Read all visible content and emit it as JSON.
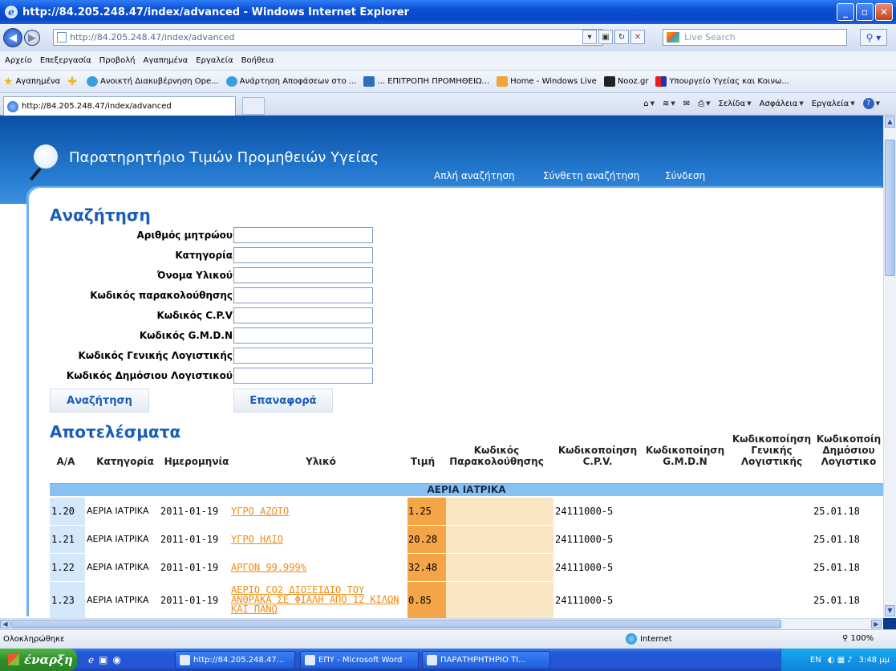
{
  "window": {
    "title": "http://84.205.248.47/index/advanced - Windows Internet Explorer"
  },
  "address": {
    "url": "http://84.205.248.47/index/advanced",
    "search_placeholder": "Live Search"
  },
  "menu": [
    "Αρχείο",
    "Επεξεργασία",
    "Προβολή",
    "Αγαπημένα",
    "Εργαλεία",
    "Βοήθεια"
  ],
  "favorites": {
    "label": "Αγαπημένα",
    "items": [
      "Ανοικτή Διακυβέρνηση Ope...",
      "Ανάρτηση Αποφάσεων στο ...",
      "... ΕΠΙΤΡΟΠΗ ΠΡΟΜΗΘΕΙΩ...",
      "Home - Windows Live",
      "Nooz.gr",
      "Υπουργείο Υγείας και Κοινω..."
    ]
  },
  "tab": {
    "label": "http://84.205.248.47/index/advanced"
  },
  "commands": [
    "Σελίδα",
    "Ασφάλεια",
    "Εργαλεία"
  ],
  "site": {
    "title": "Παρατηρητήριο Τιμών Προμηθειών Υγείας",
    "nav": [
      "Απλή αναζήτηση",
      "Σύνθετη αναζήτηση",
      "Σύνδεση"
    ]
  },
  "search": {
    "heading": "Αναζήτηση",
    "fields": [
      "Αριθμός μητρώου",
      "Κατηγορία",
      "Όνομα Υλικού",
      "Κωδικός παρακολούθησης",
      "Κωδικός C.P.V",
      "Κωδικός G.M.D.N",
      "Κωδικός Γενικής Λογιστικής",
      "Κωδικός Δημόσιου Λογιστικού"
    ],
    "submit_label": "Αναζήτηση",
    "reset_label": "Επαναφορά"
  },
  "results": {
    "heading": "Αποτελέσματα",
    "columns": {
      "id": "Α/Α",
      "category": "Κατηγορία",
      "date": "Ημερομηνία",
      "item": "Υλικό",
      "price": "Τιμή",
      "tracking": "Κωδικός Παρακολούθησης",
      "cpv": "Κωδικοποίηση C.P.V.",
      "gmdn": "Κωδικοποίηση G.M.D.N",
      "general": "Κωδικοποίηση Γενικής Λογιστικής",
      "public": "Κωδικοποίη Δημόσιου Λογιστικο"
    },
    "group": "ΑΕΡΙΑ ΙΑΤΡΙΚΑ",
    "rows": [
      {
        "id": "1.20",
        "category": "ΑΕΡΙΑ ΙΑΤΡΙΚΑ",
        "date": "2011-01-19",
        "item": "ΥΓΡΟ ΑΖΩΤΟ",
        "price": "1.25",
        "cpv": "24111000-5",
        "public": "25.01.18"
      },
      {
        "id": "1.21",
        "category": "ΑΕΡΙΑ ΙΑΤΡΙΚΑ",
        "date": "2011-01-19",
        "item": "ΥΓΡΟ ΗΛΙΟ",
        "price": "20.28",
        "cpv": "24111000-5",
        "public": "25.01.18"
      },
      {
        "id": "1.22",
        "category": "ΑΕΡΙΑ ΙΑΤΡΙΚΑ",
        "date": "2011-01-19",
        "item": "ΑΡΓΟΝ 99.999%",
        "price": "32.48",
        "cpv": "24111000-5",
        "public": "25.01.18"
      },
      {
        "id": "1.23",
        "category": "ΑΕΡΙΑ ΙΑΤΡΙΚΑ",
        "date": "2011-01-19",
        "item": "ΑΕΡΙΟ CO2 ΔΙΟΞΕΙΔΙΟ ΤΟΥ ΑΝΘΡΑΚΑ ΣΕ ΦΙΑΛΗ ΑΠΟ 12 ΚΙΛΩΝ ΚΑΙ ΠΑΝΩ",
        "price": "0.85",
        "cpv": "24111000-5",
        "public": "25.01.18"
      }
    ]
  },
  "status": {
    "text": "Ολοκληρώθηκε",
    "zone": "Internet",
    "zoom": "100%"
  },
  "taskbar": {
    "start": "έναρξη",
    "tasks": [
      "http://84.205.248.47...",
      "ΕΠΥ - Microsoft Word",
      "ΠΑΡΑΤΗΡΗΤΗΡΙΟ ΤΙ..."
    ],
    "lang": "EN",
    "clock": "3:48 μμ"
  },
  "colors": {
    "accent": "#1a5db8",
    "header": "#1f73c9",
    "price_cell": "#f3a548",
    "group_bar": "#87c1f3",
    "link": "#f08b13"
  }
}
